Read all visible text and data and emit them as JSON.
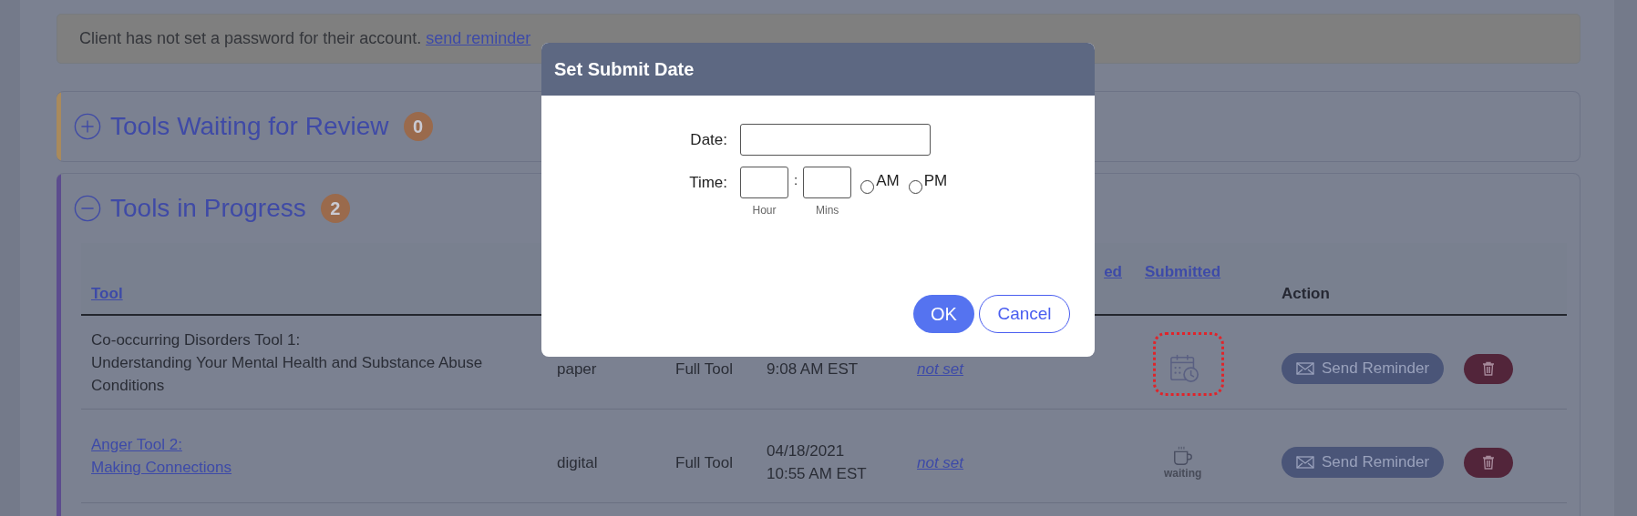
{
  "notice": {
    "text": "Client has not set a password for their account.",
    "link": "send reminder"
  },
  "panels": [
    {
      "title": "Tools Waiting for Review",
      "count": "0",
      "expanded": false,
      "color": "#a98a5c"
    },
    {
      "title": "Tools in Progress",
      "count": "2",
      "expanded": true,
      "color": "#5c4c8e"
    }
  ],
  "table": {
    "columns": {
      "tool": "Tool",
      "column_5": "ed",
      "submitted": "Submitted",
      "action": "Action"
    },
    "rows": [
      {
        "tool_lines": [
          "Co-occurring Disorders Tool 1:",
          "Understanding Your Mental Health and Substance Abuse Conditions"
        ],
        "tool_link": false,
        "format": "paper",
        "type": "Full Tool",
        "date_lines": [
          "9:08 AM EST"
        ],
        "due": "not set",
        "submitted": {
          "kind": "scheduled"
        },
        "highlighted": true,
        "action": "Send Reminder"
      },
      {
        "tool_lines": [
          "Anger Tool 2:",
          "Making Connections"
        ],
        "tool_link": true,
        "format": "digital",
        "type": "Full Tool",
        "date_lines": [
          "04/18/2021",
          "10:55 AM EST"
        ],
        "due": "not set",
        "submitted": {
          "kind": "waiting",
          "label": "waiting"
        },
        "highlighted": false,
        "action": "Send Reminder"
      }
    ]
  },
  "dialog": {
    "title": "Set Submit Date",
    "date_label": "Date:",
    "time_label": "Time:",
    "separator": ":",
    "hour_hint": "Hour",
    "mins_hint": "Mins",
    "periods": [
      {
        "label": "AM",
        "selected": false
      },
      {
        "label": "PM",
        "selected": false
      }
    ],
    "ok": "OK",
    "cancel": "Cancel"
  }
}
